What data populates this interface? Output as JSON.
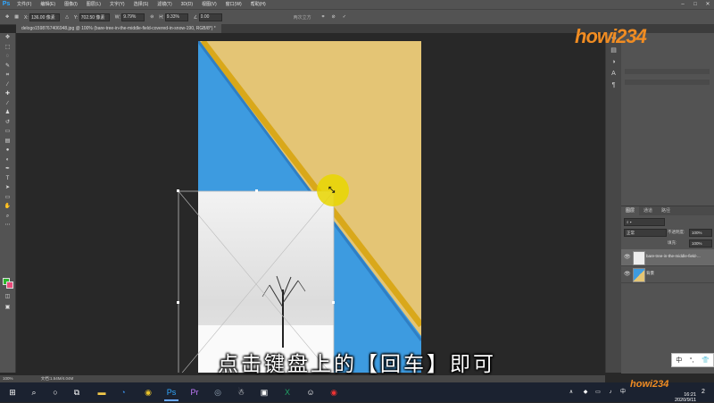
{
  "menubar": {
    "logo": "Ps",
    "items": [
      "文件(F)",
      "编辑(E)",
      "图像(I)",
      "图层(L)",
      "文字(Y)",
      "选择(S)",
      "滤镜(T)",
      "3D(D)",
      "视图(V)",
      "窗口(W)",
      "帮助(H)"
    ]
  },
  "options": {
    "x_label": "X:",
    "x_value": "136.00 像素",
    "y_label": "Y:",
    "y_value": "702.50 像素",
    "w_label": "W:",
    "w_value": "9.79%",
    "h_label": "H:",
    "h_value": "9.33%",
    "angle_value": "0.00",
    "interp_label": "两次立方"
  },
  "document_tab": {
    "label": "delogo1598767406948.jpg @ 100% (bare-tree-in-the-middle-field-covered-in-snow-190, RGB/8*) *"
  },
  "layers": {
    "tabs": [
      "图层",
      "通道",
      "路径"
    ],
    "blend_mode": "正常",
    "opacity_label": "不透明度:",
    "opacity": "100%",
    "fill_label": "填充:",
    "fill": "100%",
    "rows": [
      {
        "name": "bare-tree-in-the-middle-field-..."
      },
      {
        "name": "背景"
      }
    ]
  },
  "subtitle": "点击键盘上的【回车】即可",
  "status": {
    "zoom": "100%",
    "doc": "文档:1.54M/4.04M"
  },
  "taskbar": {
    "time": "16:21",
    "date": "2020/9/11",
    "notif_count": "2"
  },
  "watermark": "howi234",
  "ime": {
    "lang": "中",
    "punct": "°,"
  },
  "colors": {
    "accent": "#31a8ff",
    "canvas_yellow": "#e4c575",
    "canvas_blue": "#3d9be0",
    "ring_yellow": "#e9d600",
    "foreground": "#2db52d",
    "background": "#e84c7a"
  }
}
